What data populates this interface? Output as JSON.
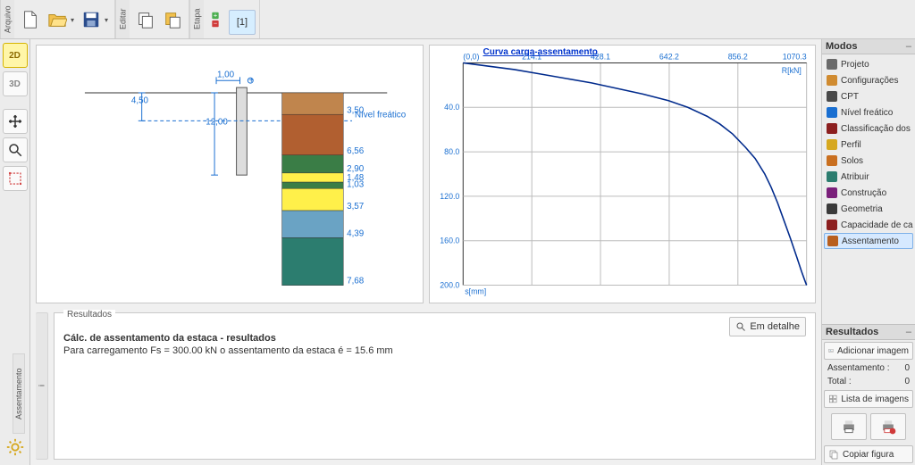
{
  "toolbar": {
    "groups": {
      "arquivo": "Arquivo",
      "editar": "Editar",
      "etapa": "Etapa"
    },
    "stage_label": "[1]"
  },
  "left_tools": {
    "view2d": "2D",
    "view3d": "3D"
  },
  "soil_view": {
    "top_dim": "1,00",
    "left_dim": "4,50",
    "mid_dim": "12,00",
    "water_label": "Nível freático",
    "layers": [
      {
        "thk": "3,50",
        "color": "#c0854d"
      },
      {
        "thk": "6,56",
        "color": "#b15f30"
      },
      {
        "thk": "2,90",
        "color": "#3a7d46"
      },
      {
        "thk": "1,48",
        "color": "#fff04a"
      },
      {
        "thk": "1,03",
        "color": "#3a7d46"
      },
      {
        "thk": "3,57",
        "color": "#fff04a"
      },
      {
        "thk": "4,39",
        "color": "#6aa3c4"
      },
      {
        "thk": "7,68",
        "color": "#2c7d6f"
      }
    ]
  },
  "chart_data": {
    "type": "line",
    "title": "Curva carga-assentamento",
    "xlabel": "R[kN]",
    "ylabel": "s[mm]",
    "x_ticks": [
      0.0,
      214.1,
      428.1,
      642.2,
      856.2,
      1070.3
    ],
    "y_ticks": [
      0.0,
      40.0,
      80.0,
      120.0,
      160.0,
      200.0
    ],
    "xlim": [
      0,
      1070.3
    ],
    "ylim": [
      0,
      200
    ],
    "series": [
      {
        "name": "carga-assentamento",
        "x": [
          0,
          80,
          160,
          240,
          320,
          400,
          480,
          560,
          640,
          700,
          760,
          800,
          840,
          880,
          910,
          940,
          960,
          980,
          1000,
          1020,
          1040,
          1055,
          1065,
          1070.3
        ],
        "y": [
          0,
          3,
          6,
          10,
          14,
          18,
          23,
          28,
          34,
          40,
          48,
          55,
          64,
          76,
          86,
          100,
          112,
          126,
          142,
          158,
          175,
          188,
          196,
          200
        ]
      }
    ]
  },
  "right": {
    "modes_header": "Modos",
    "items": [
      {
        "id": "projeto",
        "label": "Projeto",
        "color": "#6a6a6a"
      },
      {
        "id": "config",
        "label": "Configurações",
        "color": "#d08b30"
      },
      {
        "id": "cpt",
        "label": "CPT",
        "color": "#4a4a4a"
      },
      {
        "id": "nivel",
        "label": "Nível freático",
        "color": "#1a6fd1"
      },
      {
        "id": "classif",
        "label": "Classificação dos solos",
        "color": "#8c1f1f"
      },
      {
        "id": "perfil",
        "label": "Perfil",
        "color": "#d6a81f"
      },
      {
        "id": "solos",
        "label": "Solos",
        "color": "#c96f1f"
      },
      {
        "id": "atribuir",
        "label": "Atribuir",
        "color": "#2c7d6f"
      },
      {
        "id": "construcao",
        "label": "Construção",
        "color": "#7a1f7a"
      },
      {
        "id": "geometria",
        "label": "Geometria",
        "color": "#3a3a3a"
      },
      {
        "id": "capacidade",
        "label": "Capacidade de carga",
        "color": "#8c1f1f"
      },
      {
        "id": "assentamento",
        "label": "Assentamento",
        "color": "#b85f1f",
        "active": true
      }
    ],
    "resultados_header": "Resultados",
    "add_image": "Adicionar imagem",
    "row_assent_label": "Assentamento :",
    "row_assent_val": "0",
    "row_total_label": "Total :",
    "row_total_val": "0",
    "list_images": "Lista de imagens",
    "copiar_figura": "Copiar figura"
  },
  "bottom": {
    "legend": "Resultados",
    "title": "Cálc. de assentamento da estaca - resultados",
    "line1": "Para carregamento Fs = 300.00 kN o assentamento da estaca é = 15.6 mm",
    "detail_btn": "Em detalhe",
    "side_tab": "Assentamento"
  }
}
